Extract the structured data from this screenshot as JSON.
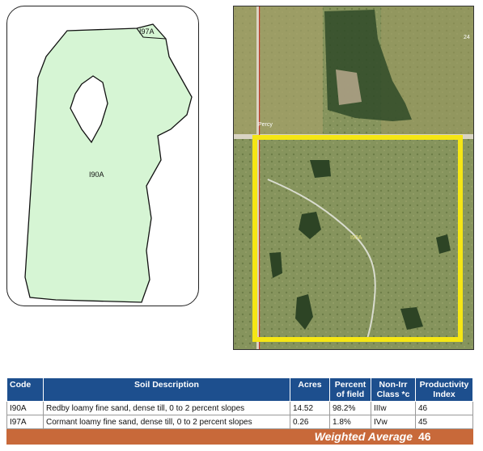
{
  "soil_map": {
    "unit_labels": [
      "I97A",
      "I90A"
    ]
  },
  "aerial": {
    "road_label": "Percy",
    "road_number": "24",
    "parcel_label": "I90A"
  },
  "table": {
    "headers": {
      "code": "Code",
      "description": "Soil Description",
      "acres": "Acres",
      "percent": "Percent of field",
      "class": "Non-Irr Class *c",
      "productivity": "Productivity Index"
    },
    "rows": [
      {
        "code": "I90A",
        "description": "Redby loamy fine sand, dense till, 0 to 2 percent slopes",
        "acres": "14.52",
        "percent": "98.2%",
        "class": "IIIw",
        "productivity": "46"
      },
      {
        "code": "I97A",
        "description": "Cormant loamy fine sand, dense till, 0 to 2 percent slopes",
        "acres": "0.26",
        "percent": "1.8%",
        "class": "IVw",
        "productivity": "45"
      }
    ],
    "weighted_average_label": "Weighted Average",
    "weighted_average_value": "46"
  },
  "colors": {
    "soil_fill": "#d6f5d4",
    "header_blue": "#1d4f8e",
    "average_orange": "#c8693a",
    "boundary_yellow": "#f5e614"
  }
}
